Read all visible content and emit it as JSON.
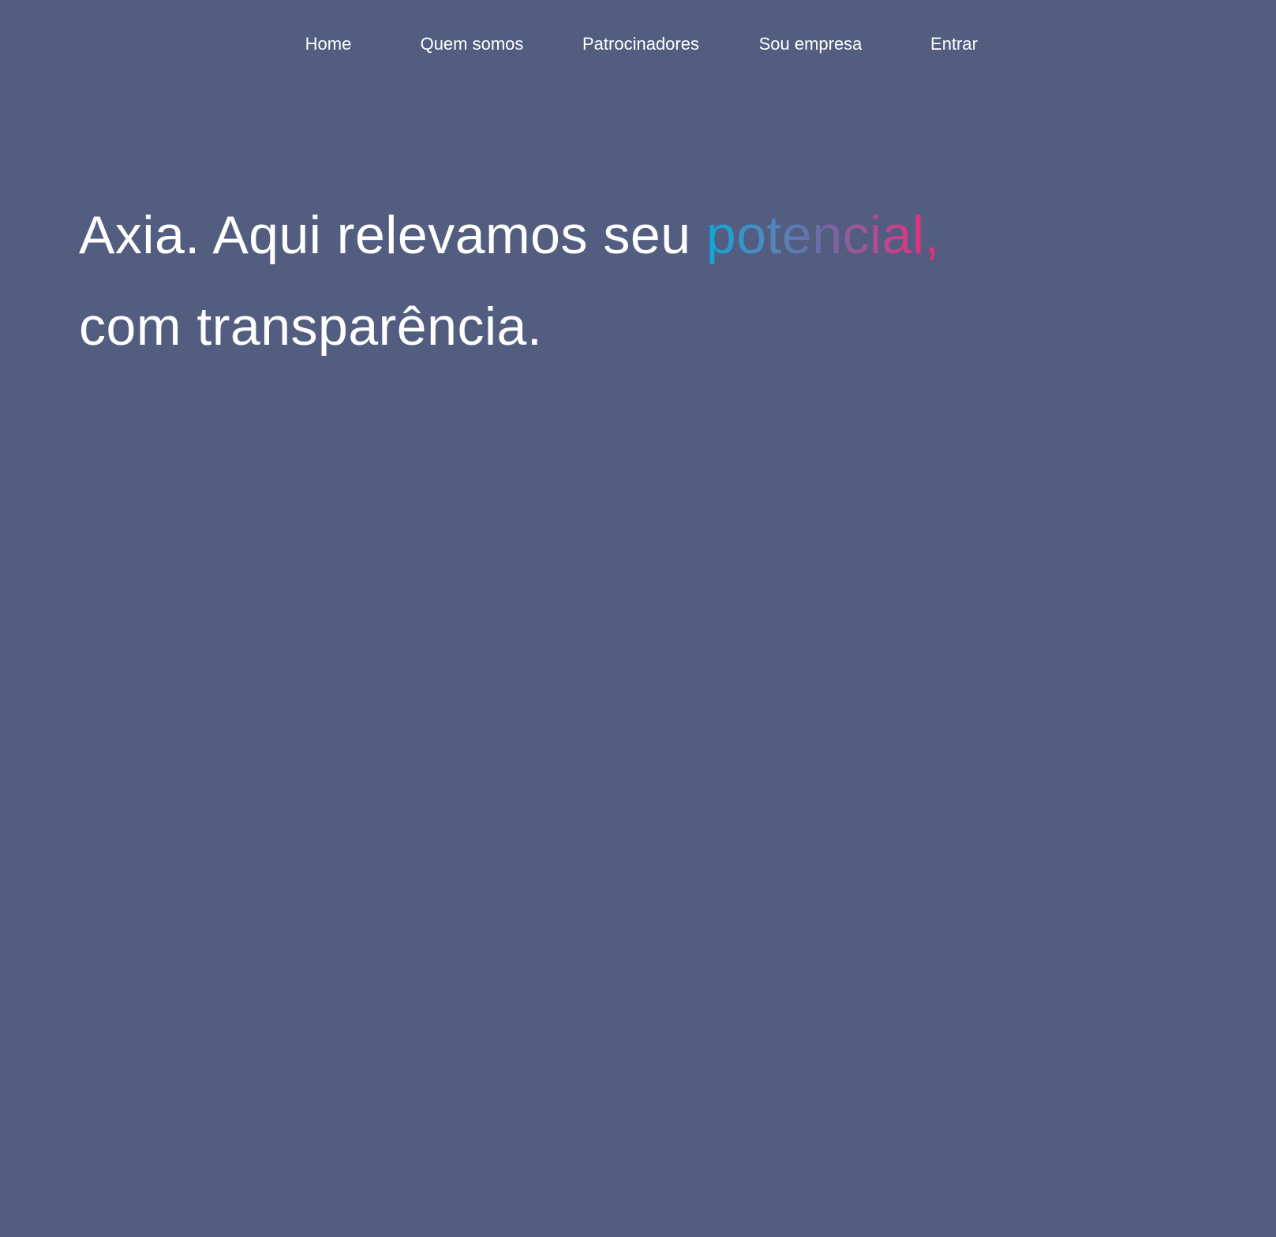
{
  "nav": {
    "items": [
      {
        "label": "Home"
      },
      {
        "label": "Quem somos"
      },
      {
        "label": "Patrocinadores"
      },
      {
        "label": "Sou empresa"
      },
      {
        "label": "Entrar"
      }
    ]
  },
  "hero": {
    "line1_text": "Axia. Aqui relevamos seu ",
    "highlight_text": "potencial,",
    "line2_text": "com transparência."
  },
  "colors": {
    "background": "#525d80",
    "text": "#ffffff",
    "gradient_start": "#0ea7d8",
    "gradient_end": "#ee2a77"
  }
}
